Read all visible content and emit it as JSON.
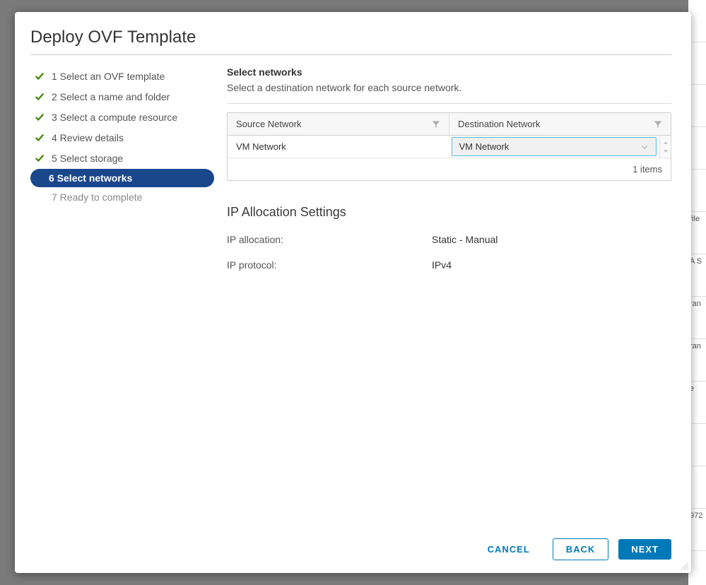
{
  "dialog_title": "Deploy OVF Template",
  "steps": [
    {
      "label": "1 Select an OVF template",
      "state": "done"
    },
    {
      "label": "2 Select a name and folder",
      "state": "done"
    },
    {
      "label": "3 Select a compute resource",
      "state": "done"
    },
    {
      "label": "4 Review details",
      "state": "done"
    },
    {
      "label": "5 Select storage",
      "state": "done"
    },
    {
      "label": "6 Select networks",
      "state": "active"
    },
    {
      "label": "7 Ready to complete",
      "state": "pending"
    }
  ],
  "content": {
    "title": "Select networks",
    "description": "Select a destination network for each source network.",
    "table": {
      "header_source": "Source Network",
      "header_destination": "Destination Network",
      "rows": [
        {
          "source": "VM Network",
          "destination": "VM Network"
        }
      ],
      "footer": "1 items"
    },
    "ip_allocation": {
      "title": "IP Allocation Settings",
      "rows": [
        {
          "label": "IP allocation:",
          "value": "Static - Manual"
        },
        {
          "label": "IP protocol:",
          "value": "IPv4"
        }
      ]
    }
  },
  "buttons": {
    "cancel": "CANCEL",
    "back": "BACK",
    "next": "NEXT"
  }
}
